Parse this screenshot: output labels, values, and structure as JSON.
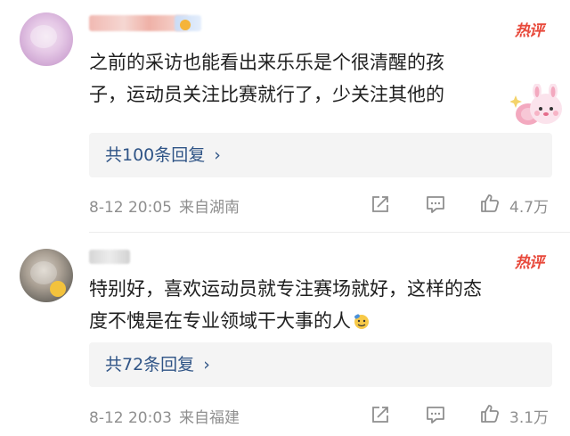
{
  "comments": [
    {
      "hot_label": "热评",
      "text_line1": "之前的采访也能看出来乐乐是个很清醒的孩",
      "text_line2": "子，运动员关注比赛就行了，少关注其他的",
      "replies_label": "共100条回复",
      "date": "8-12 20:05",
      "location": "来自湖南",
      "likes": "4.7万"
    },
    {
      "hot_label": "热评",
      "text_line1": "特别好，喜欢运动员就专注赛场就好，这样的态",
      "text_line2": "度不愧是在专业领域干大事的人",
      "replies_label": "共72条回复",
      "date": "8-12 20:03",
      "location": "来自福建",
      "likes": "3.1万"
    }
  ],
  "icons": {
    "chevron": "chevron-right-icon",
    "share": "share-icon",
    "comment": "comment-icon",
    "like": "thumbs-up-icon",
    "sticker": "bunny-sticker-icon",
    "emoji": "salute-emoji-icon"
  },
  "colors": {
    "hot": "#e8493b",
    "reply_link": "#2f5486",
    "meta": "#8f8f8f",
    "reply_bg": "#f4f4f4"
  }
}
